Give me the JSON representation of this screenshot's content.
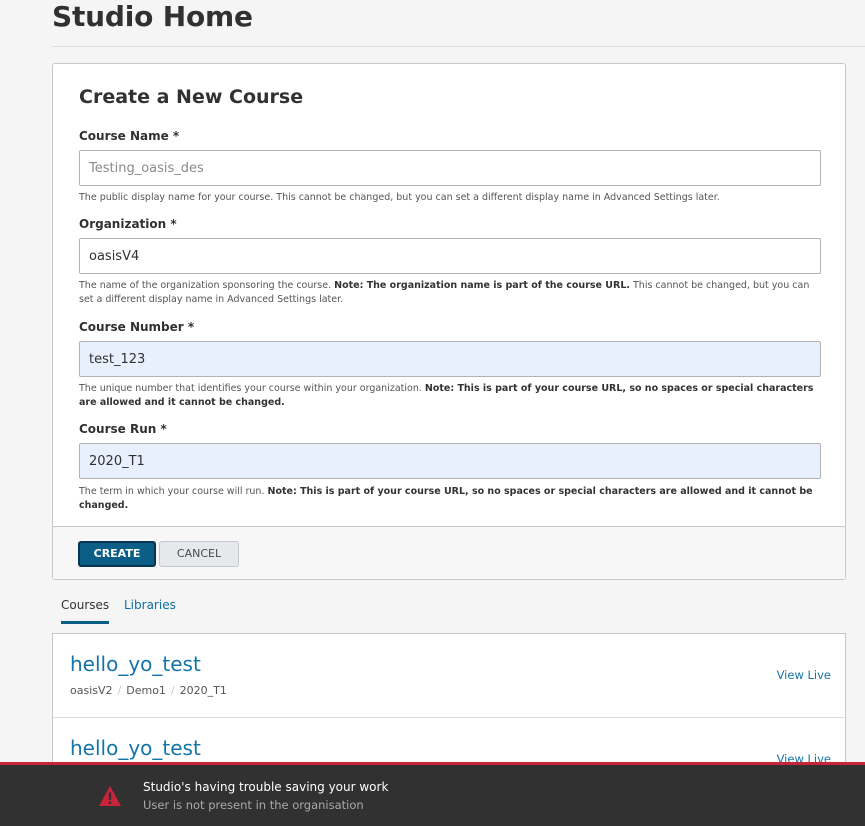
{
  "page": {
    "title": "Studio Home"
  },
  "create_form": {
    "heading": "Create a New Course",
    "course_name": {
      "label": "Course Name *",
      "value": "Testing_oasis_des",
      "help": "The public display name for your course. This cannot be changed, but you can set a different display name in Advanced Settings later."
    },
    "organization": {
      "label": "Organization *",
      "value": "oasisV4",
      "help_pre": "The name of the organization sponsoring the course. ",
      "help_bold": "Note: The organization name is part of the course URL.",
      "help_post": " This cannot be changed, but you can set a different display name in Advanced Settings later."
    },
    "course_number": {
      "label": "Course Number *",
      "value": "test_123",
      "help_pre": "The unique number that identifies your course within your organization. ",
      "help_bold": "Note: This is part of your course URL, so no spaces or special characters are allowed and it cannot be changed."
    },
    "course_run": {
      "label": "Course Run *",
      "value": "2020_T1",
      "help_pre": "The term in which your course will run. ",
      "help_bold": "Note: This is part of your course URL, so no spaces or special characters are allowed and it cannot be changed."
    },
    "create_label": "CREATE",
    "cancel_label": "CANCEL"
  },
  "tabs": {
    "courses": "Courses",
    "libraries": "Libraries"
  },
  "courses": [
    {
      "title": "hello_yo_test",
      "org": "oasisV2",
      "number": "Demo1",
      "run": "2020_T1",
      "action": "View Live"
    },
    {
      "title": "hello_yo_test",
      "action": "View Live"
    }
  ],
  "alert": {
    "icon": "warning-icon",
    "title": "Studio's having trouble saving your work",
    "message": "User is not present in the organisation",
    "accent_color": "#c8243a"
  }
}
